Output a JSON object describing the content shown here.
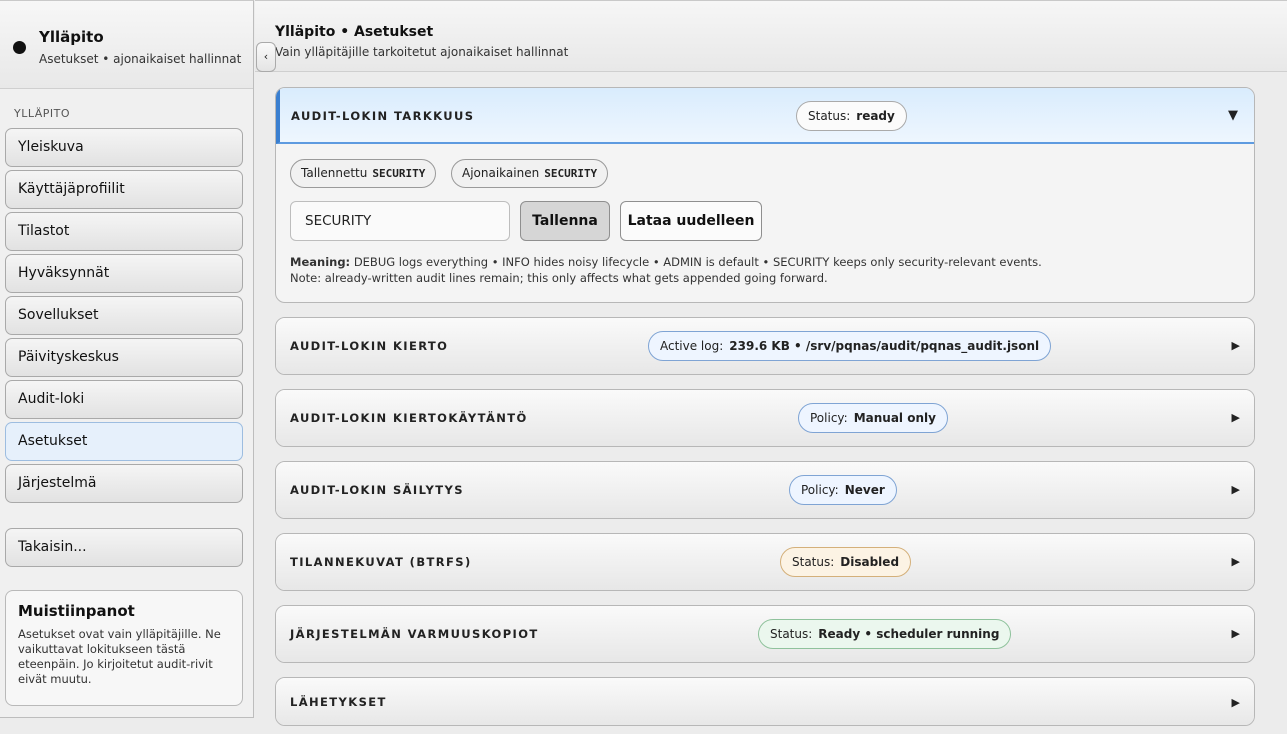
{
  "sidebar": {
    "title": "Ylläpito",
    "subtitle": "Asetukset • ajonaikaiset hallinnat",
    "section_label": "YLLÄPITO",
    "items": [
      {
        "label": "Yleiskuva"
      },
      {
        "label": "Käyttäjäprofiilit"
      },
      {
        "label": "Tilastot"
      },
      {
        "label": "Hyväksynnät"
      },
      {
        "label": "Sovellukset"
      },
      {
        "label": "Päivityskeskus"
      },
      {
        "label": "Audit-loki"
      },
      {
        "label": "Asetukset",
        "active": true
      },
      {
        "label": "Järjestelmä"
      }
    ],
    "back_label": "Takaisin...",
    "notes_title": "Muistiinpanot",
    "notes_body": "Asetukset ovat vain ylläpitäjille. Ne vaikuttavat lokitukseen tästä eteenpäin. Jo kirjoitetut audit-rivit eivät muutu."
  },
  "collapse_glyph": "‹",
  "header": {
    "title": "Ylläpito • Asetukset",
    "subtitle": "Vain ylläpitäjille tarkoitetut ajonaikaiset hallinnat"
  },
  "panels": [
    {
      "title": "AUDIT-LOKIN TARKKUUS",
      "chip_label": "Status:",
      "chip_value": "ready",
      "chip_style": "neutral",
      "open": true,
      "chevron": "▼",
      "saved_label": "Tallennettu",
      "saved_value": "SECURITY",
      "runtime_label": "Ajonaikainen",
      "runtime_value": "SECURITY",
      "input_value": "SECURITY",
      "save_label": "Tallenna",
      "reload_label": "Lataa uudelleen",
      "meaning_label": "Meaning:",
      "meaning_text": "DEBUG logs everything • INFO hides noisy lifecycle • ADMIN is default • SECURITY keeps only security-relevant events.",
      "note_text": "Note: already-written audit lines remain; this only affects what gets appended going forward."
    },
    {
      "title": "AUDIT-LOKIN KIERTO",
      "chip_label": "Active log:",
      "chip_value": "239.6 KB • /srv/pqnas/audit/pqnas_audit.jsonl",
      "chip_style": "blue",
      "chevron": "▶"
    },
    {
      "title": "AUDIT-LOKIN KIERTOKÄYTÄNTÖ",
      "chip_label": "Policy:",
      "chip_value": "Manual only",
      "chip_style": "blue",
      "chevron": "▶"
    },
    {
      "title": "AUDIT-LOKIN SÄILYTYS",
      "chip_label": "Policy:",
      "chip_value": "Never",
      "chip_style": "blue",
      "chevron": "▶"
    },
    {
      "title": "TILANNEKUVAT (BTRFS)",
      "chip_label": "Status:",
      "chip_value": "Disabled",
      "chip_style": "orange",
      "chevron": "▶"
    },
    {
      "title": "JÄRJESTELMÄN VARMUUSKOPIOT",
      "chip_label": "Status:",
      "chip_value": "Ready • scheduler running",
      "chip_style": "green",
      "chevron": "▶"
    },
    {
      "title": "LÄHETYKSET",
      "chevron": "▶"
    }
  ]
}
